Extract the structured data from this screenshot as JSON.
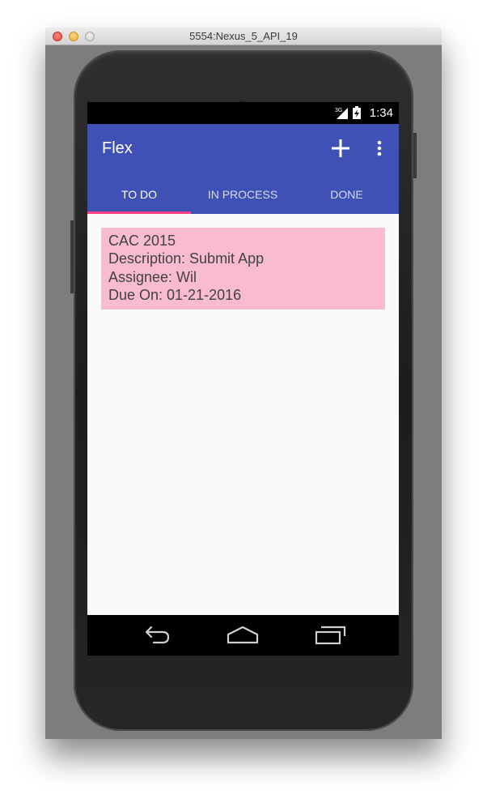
{
  "window": {
    "title": "5554:Nexus_5_API_19"
  },
  "status_bar": {
    "network": "3G",
    "time": "1:34"
  },
  "app_bar": {
    "title": "Flex",
    "actions": [
      "add-icon",
      "more-vert-icon"
    ],
    "color": "#3f51b5"
  },
  "tabs": [
    {
      "label": "TO DO",
      "selected": true
    },
    {
      "label": "IN PROCESS",
      "selected": false
    },
    {
      "label": "DONE",
      "selected": false
    }
  ],
  "tab_indicator_color": "#ff4081",
  "tasks": [
    {
      "title": "CAC 2015",
      "description": "Description: Submit App",
      "assignee": "Assignee: Wil",
      "due": "Due On: 01-21-2016",
      "color": "#f8bbd0"
    }
  ],
  "nav_bar": {
    "buttons": [
      "back-icon",
      "home-icon",
      "recents-icon"
    ]
  }
}
